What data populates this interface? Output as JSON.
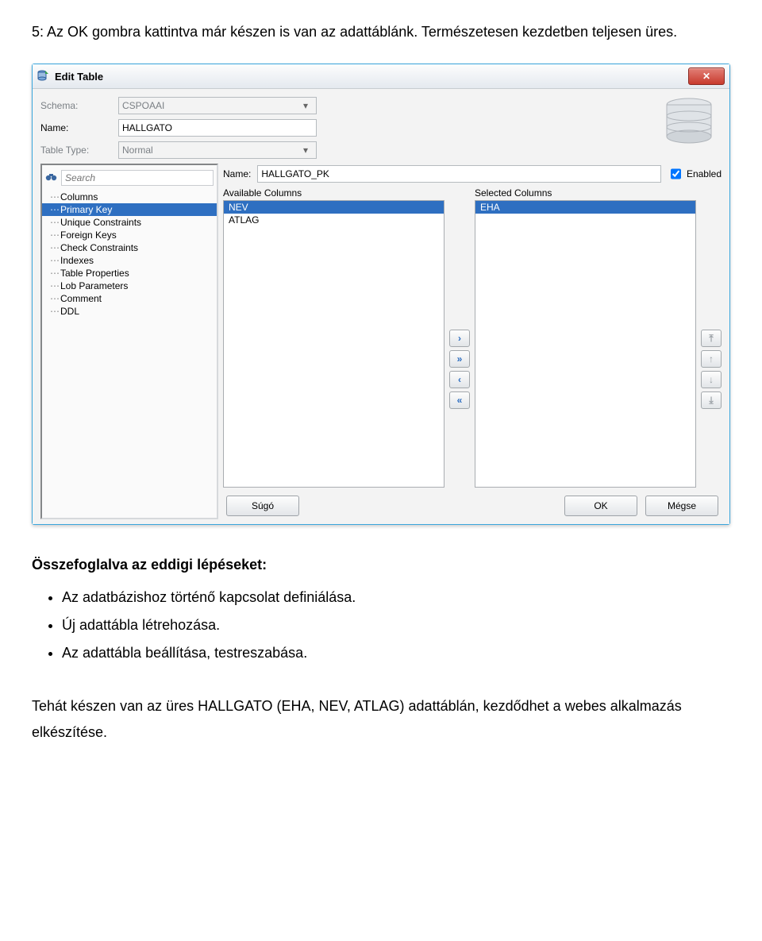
{
  "doc": {
    "intro": "5: Az OK gombra kattintva már készen is van az adattáblánk. Természetesen kezdetben teljesen üres.",
    "summary_head": "Összefoglalva az eddigi lépéseket:",
    "summary_items": [
      "Az adatbázishoz történő kapcsolat definiálása.",
      "Új adattábla létrehozása.",
      "Az adattábla beállítása, testreszabása."
    ],
    "closing": "Tehát készen van az üres HALLGATO (EHA, NEV, ATLAG) adattáblán, kezdődhet a webes alkalmazás elkészítése."
  },
  "dialog": {
    "title": "Edit Table",
    "labels": {
      "schema": "Schema:",
      "name": "Name:",
      "table_type": "Table Type:"
    },
    "schema_value": "CSPOAAI",
    "name_value": "HALLGATO",
    "table_type_value": "Normal",
    "search_placeholder": "Search",
    "tree": [
      "Columns",
      "Primary Key",
      "Unique Constraints",
      "Foreign Keys",
      "Check Constraints",
      "Indexes",
      "Table Properties",
      "Lob Parameters",
      "Comment",
      "DDL"
    ],
    "tree_selected": "Primary Key",
    "pk": {
      "name_label": "Name:",
      "name_value": "HALLGATO_PK",
      "enabled_label": "Enabled",
      "enabled_checked": true,
      "available_label": "Available Columns",
      "selected_label": "Selected Columns",
      "available": [
        "NEV",
        "ATLAG"
      ],
      "selected": [
        "EHA"
      ]
    },
    "buttons": {
      "help": "Súgó",
      "ok": "OK",
      "cancel": "Mégse"
    }
  }
}
